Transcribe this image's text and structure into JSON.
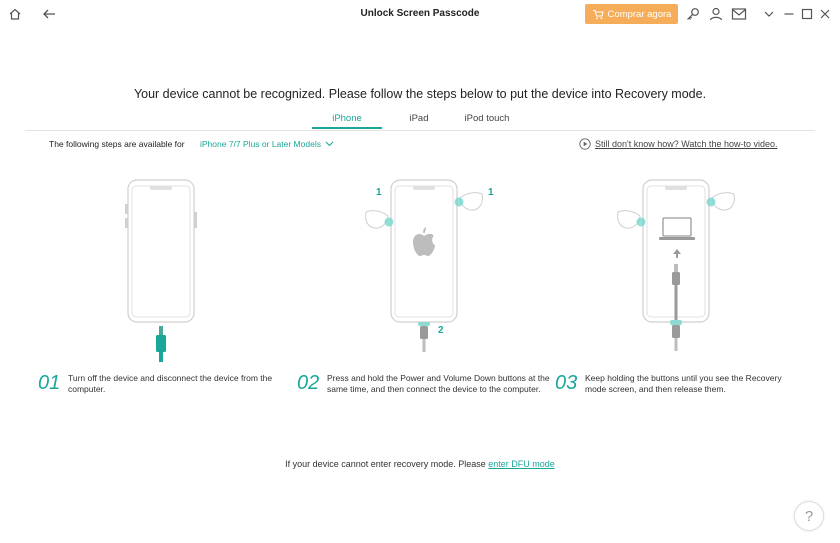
{
  "window": {
    "title": "Unlock Screen Passcode",
    "buy_label": "Comprar agora",
    "icons": [
      "home-icon",
      "back-icon",
      "key-icon",
      "user-icon",
      "mail-icon",
      "chevron-down-icon",
      "minimize-icon",
      "maximize-icon",
      "close-icon"
    ]
  },
  "main": {
    "headline": "Your device cannot be recognized. Please follow the steps below to put the device into Recovery mode.",
    "tabs": [
      {
        "label": "iPhone",
        "active": true
      },
      {
        "label": "iPad",
        "active": false
      },
      {
        "label": "iPod touch",
        "active": false
      }
    ],
    "available_label": "The following steps are available for",
    "model_selected": "iPhone 7/7 Plus or Later Models",
    "howto_label": "Still don't know how? Watch the how-to video."
  },
  "steps": [
    {
      "num": "01",
      "text": "Turn off the device and disconnect the device from the computer."
    },
    {
      "num": "02",
      "text": "Press and hold the Power and Volume Down buttons at the same time, and then connect the device to the computer."
    },
    {
      "num": "03",
      "text": "Keep holding the buttons until you see the Recovery mode screen, and then release them."
    }
  ],
  "callouts": {
    "a": "1",
    "b": "1",
    "c": "2"
  },
  "footer": {
    "prefix": "If your device cannot enter recovery mode. Please ",
    "link": "enter DFU mode"
  },
  "help_label": "?",
  "colors": {
    "accent": "#1aa79a",
    "buy": "#f6ad5a",
    "phone_outline": "#cfcfcf"
  }
}
